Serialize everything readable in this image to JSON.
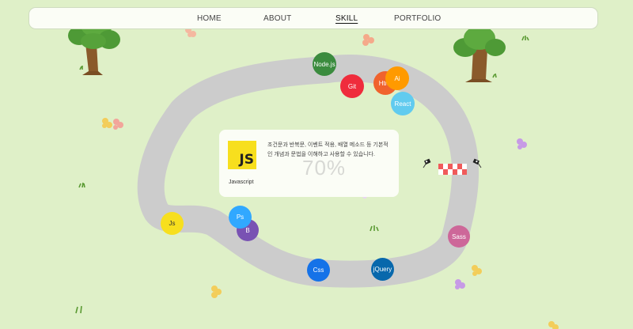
{
  "nav": {
    "items": [
      {
        "label": "HOME"
      },
      {
        "label": "ABOUT"
      },
      {
        "label": "SKILL",
        "active": true
      },
      {
        "label": "PORTFOLIO"
      }
    ]
  },
  "skills": [
    {
      "label": "Node.js",
      "color": "#3b8b3e"
    },
    {
      "label": "Git",
      "color": "#ef2c3c"
    },
    {
      "label": "Html",
      "color": "#f0622d"
    },
    {
      "label": "Ai",
      "color": "#ff9a00"
    },
    {
      "label": "React",
      "color": "#61cbef"
    },
    {
      "label": "Sass",
      "color": "#cd6799"
    },
    {
      "label": "jQuery",
      "color": "#0868ac"
    },
    {
      "label": "Css",
      "color": "#1572e8"
    },
    {
      "label": "Js",
      "color": "#f7df1e"
    },
    {
      "label": "Ps",
      "color": "#31a8ff"
    },
    {
      "label": "B",
      "color": "#7952b3"
    }
  ],
  "detail": {
    "logo_text": "JS",
    "name": "Javascript",
    "description": "조건문과 반복문, 이벤트 적용, 배열 메소드 등 기본적인 개념과 문법을 이해하고 사용할 수 있습니다.",
    "percent": "70%"
  },
  "colors": {
    "background": "#dff0c8",
    "track": "#cccccc",
    "finish_line": "#f05a5a"
  }
}
